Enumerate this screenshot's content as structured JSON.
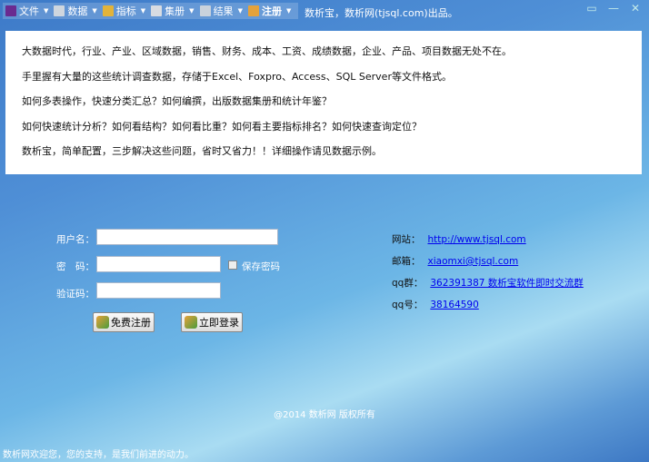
{
  "menu": [
    {
      "label": "文件",
      "icon": "chart-icon",
      "color": "#6a2b90"
    },
    {
      "label": "数据",
      "icon": "database-icon",
      "color": "#cfd6de"
    },
    {
      "label": "指标",
      "icon": "key-icon",
      "color": "#e2b33a"
    },
    {
      "label": "集册",
      "icon": "edit-icon",
      "color": "#d8dce2"
    },
    {
      "label": "结果",
      "icon": "bar-chart-icon",
      "color": "#c9d2dc"
    },
    {
      "label": "注册",
      "icon": "users-icon",
      "color": "#e4a23c"
    }
  ],
  "byline": "数析宝，数析网(tjsql.com)出品。",
  "intro": [
    "大数据时代，行业、产业、区域数据，销售、财务、成本、工资、成绩数据，企业、产品、项目数据无处不在。",
    "手里握有大量的这些统计调查数据，存储于Excel、Foxpro、Access、SQL  Server等文件格式。",
    "如何多表操作，快速分类汇总？如何编撰，出版数据集册和统计年鉴？",
    "如何快速统计分析？如何看结构？如何看比重？如何看主要指标排名？如何快速查询定位？",
    "数析宝，简单配置，三步解决这些问题，省时又省力！！详细操作请见数据示例。"
  ],
  "form": {
    "username_label": "用户名：",
    "password_label": "密　码：",
    "captcha_label": "验证码：",
    "username": "",
    "password": "",
    "captcha": "",
    "save_password": "保存密码",
    "save_checked": false,
    "register": "免费注册",
    "login": "立即登录"
  },
  "contact": {
    "site_label": "网站：",
    "site": "http://www.tjsql.com",
    "email_label": "邮箱：",
    "email": "xiaomxi@tjsql.com",
    "group_label": "qq群：",
    "group": "362391387 数析宝软件即时交流群",
    "qq_label": "qq号：",
    "qq": "38164590"
  },
  "footer": "@2014 数析网 版权所有",
  "status": "数析网欢迎您，您的支持，是我们前进的动力。"
}
